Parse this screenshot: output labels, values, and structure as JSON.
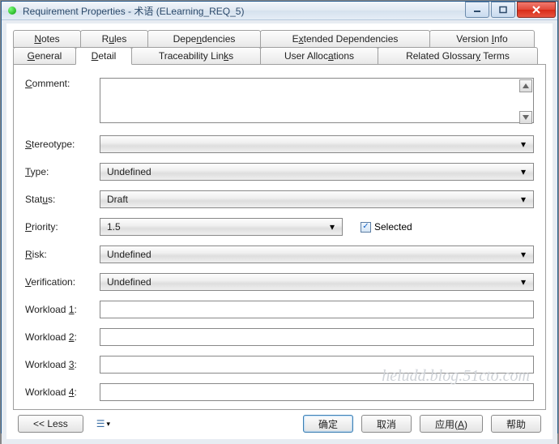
{
  "window": {
    "title": "Requirement Properties - 术语 (ELearning_REQ_5)"
  },
  "tabs_row1": [
    {
      "label_pre": "",
      "u": "N",
      "label_post": "otes"
    },
    {
      "label_pre": "R",
      "u": "u",
      "label_post": "les"
    },
    {
      "label_pre": "Depe",
      "u": "n",
      "label_post": "dencies"
    },
    {
      "label_pre": "E",
      "u": "x",
      "label_post": "tended Dependencies"
    },
    {
      "label_pre": "Version ",
      "u": "I",
      "label_post": "nfo"
    }
  ],
  "tabs_row2": [
    {
      "label_pre": "",
      "u": "G",
      "label_post": "eneral"
    },
    {
      "label_pre": "",
      "u": "D",
      "label_post": "etail"
    },
    {
      "label_pre": "Traceability Lin",
      "u": "k",
      "label_post": "s"
    },
    {
      "label_pre": "User Alloc",
      "u": "a",
      "label_post": "tions"
    },
    {
      "label_pre": "Related Glossar",
      "u": "y",
      "label_post": " Terms"
    }
  ],
  "active_tab": "Detail",
  "fields": {
    "comment": {
      "label_pre": "",
      "u": "C",
      "label_post": "omment:",
      "value": ""
    },
    "stereotype": {
      "label_pre": "",
      "u": "S",
      "label_post": "tereotype:",
      "value": ""
    },
    "type": {
      "label_pre": "",
      "u": "T",
      "label_post": "ype:",
      "value": "Undefined"
    },
    "status": {
      "label_pre": "Stat",
      "u": "u",
      "label_post": "s:",
      "value": "Draft"
    },
    "priority": {
      "label_pre": "",
      "u": "P",
      "label_post": "riority:",
      "value": "1.5"
    },
    "selected": {
      "label": "Selected",
      "checked": true
    },
    "risk": {
      "label_pre": "",
      "u": "R",
      "label_post": "isk:",
      "value": "Undefined"
    },
    "verification": {
      "label_pre": "",
      "u": "V",
      "label_post": "erification:",
      "value": "Undefined"
    },
    "workload1": {
      "label_pre": "Workload ",
      "u": "1",
      "label_post": ":",
      "value": ""
    },
    "workload2": {
      "label_pre": "Workload ",
      "u": "2",
      "label_post": ":",
      "value": ""
    },
    "workload3": {
      "label_pre": "Workload ",
      "u": "3",
      "label_post": ":",
      "value": ""
    },
    "workload4": {
      "label_pre": "Workload ",
      "u": "4",
      "label_post": ":",
      "value": ""
    }
  },
  "footer": {
    "less": "<< Less",
    "ok": "确定",
    "cancel": "取消",
    "apply_pre": "应用(",
    "apply_u": "A",
    "apply_post": ")",
    "help": "帮助"
  },
  "watermark": "heludd.blog.51cto.com"
}
